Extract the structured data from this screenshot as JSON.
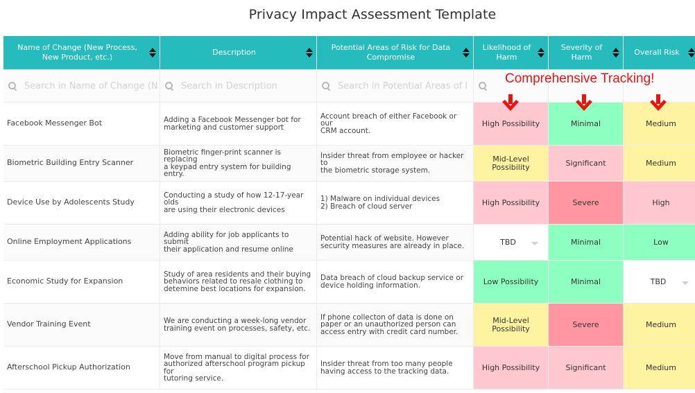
{
  "page": {
    "title": "Privacy Impact Assessment Template"
  },
  "annotation": {
    "text": "Comprehensive Tracking!",
    "color": "#ee1111"
  },
  "colors": {
    "header": "#26bcbd",
    "high_pink": "#ffc7ce",
    "severe_red": "#ff96a0",
    "medium_yellow": "#fff2a0",
    "low_green": "#8dffc0",
    "tbd_white": "#ffffff"
  },
  "table": {
    "columns": [
      {
        "label": "Name of Change (New Process, New Product, etc.)",
        "search_placeholder": "Search in Name of Change (N"
      },
      {
        "label": "Description",
        "search_placeholder": "Search in Description"
      },
      {
        "label": "Potential Areas of Risk for Data Compromise",
        "search_placeholder": "Search in Potential Areas of I"
      },
      {
        "label": "Likelihood of Harm",
        "search_placeholder": ""
      },
      {
        "label": "Severity of Harm",
        "search_placeholder": ""
      },
      {
        "label": "Overall Risk",
        "search_placeholder": ""
      }
    ],
    "rows": [
      {
        "name": "Facebook Messenger Bot",
        "description": "Adding a Facebook Messenger bot for\nmarketing and customer support",
        "risk_areas": "Account breach of either Facebook or our\nCRM account.",
        "likelihood": {
          "value": "High Possibility",
          "color": "#ffc7ce"
        },
        "severity": {
          "value": "Minimal",
          "color": "#8dffc0"
        },
        "overall": {
          "value": "Medium",
          "color": "#fff2a0"
        }
      },
      {
        "name": "Biometric Building Entry Scanner",
        "description": "Biometric finger-print scanner is replacing\na keypad entry system for building entry.",
        "risk_areas": "Insider threat from employee or hacker to\nthe biometric storage system.",
        "likelihood": {
          "value": "Mid-Level\nPossibility",
          "color": "#fff2a0"
        },
        "severity": {
          "value": "Significant",
          "color": "#ffc7ce"
        },
        "overall": {
          "value": "Medium",
          "color": "#fff2a0"
        }
      },
      {
        "name": "Device Use by Adolescents Study",
        "description": "Conducting a study of how 12-17-year olds\nare using their electronic devices",
        "risk_areas": "1) Malware on individual devices\n2) Breach of cloud server",
        "likelihood": {
          "value": "High Possibility",
          "color": "#ffc7ce"
        },
        "severity": {
          "value": "Severe",
          "color": "#ff96a0"
        },
        "overall": {
          "value": "High",
          "color": "#ffc7ce"
        }
      },
      {
        "name": "Online Employment Applications",
        "description": "Adding ability for job applicants to submit\ntheir application and resume online",
        "risk_areas": "Potential hack of website. However\nsecurity measures are already in place.",
        "likelihood": {
          "value": "TBD",
          "color": "#ffffff",
          "dropdown": true
        },
        "severity": {
          "value": "Minimal",
          "color": "#8dffc0"
        },
        "overall": {
          "value": "Low",
          "color": "#8dffc0"
        }
      },
      {
        "name": "Economic Study for Expansion",
        "description": "Study of area residents and their buying\nbehaviors related to resale clothing to\ndetemine best locations for expansion.",
        "risk_areas": "Data breach of cloud backup service or\ndevice holding information.",
        "likelihood": {
          "value": "Low Possibility",
          "color": "#8dffc0"
        },
        "severity": {
          "value": "Minimal",
          "color": "#8dffc0"
        },
        "overall": {
          "value": "TBD",
          "color": "#ffffff",
          "dropdown": true
        }
      },
      {
        "name": "Vendor Training Event",
        "description": "We are conducting a week-long vendor\ntraining event on processes, safety, etc.",
        "risk_areas": "If phone collecton of data is done on\npaper or an unauthorized person can\naccess entry with credit card number.",
        "likelihood": {
          "value": "Mid-Level\nPossibility",
          "color": "#fff2a0"
        },
        "severity": {
          "value": "Severe",
          "color": "#ff96a0"
        },
        "overall": {
          "value": "Medium",
          "color": "#fff2a0"
        }
      },
      {
        "name": "Afterschool Pickup Authorization",
        "description": "Move from manual to digital process for\nauthorized afterschool program pickup for\ntutoring service.",
        "risk_areas": "Insider threat from too many people\nhaving access to the tracking data.",
        "likelihood": {
          "value": "High Possibility",
          "color": "#ffc7ce"
        },
        "severity": {
          "value": "Significant",
          "color": "#ffc7ce"
        },
        "overall": {
          "value": "Medium",
          "color": "#fff2a0"
        }
      }
    ]
  }
}
